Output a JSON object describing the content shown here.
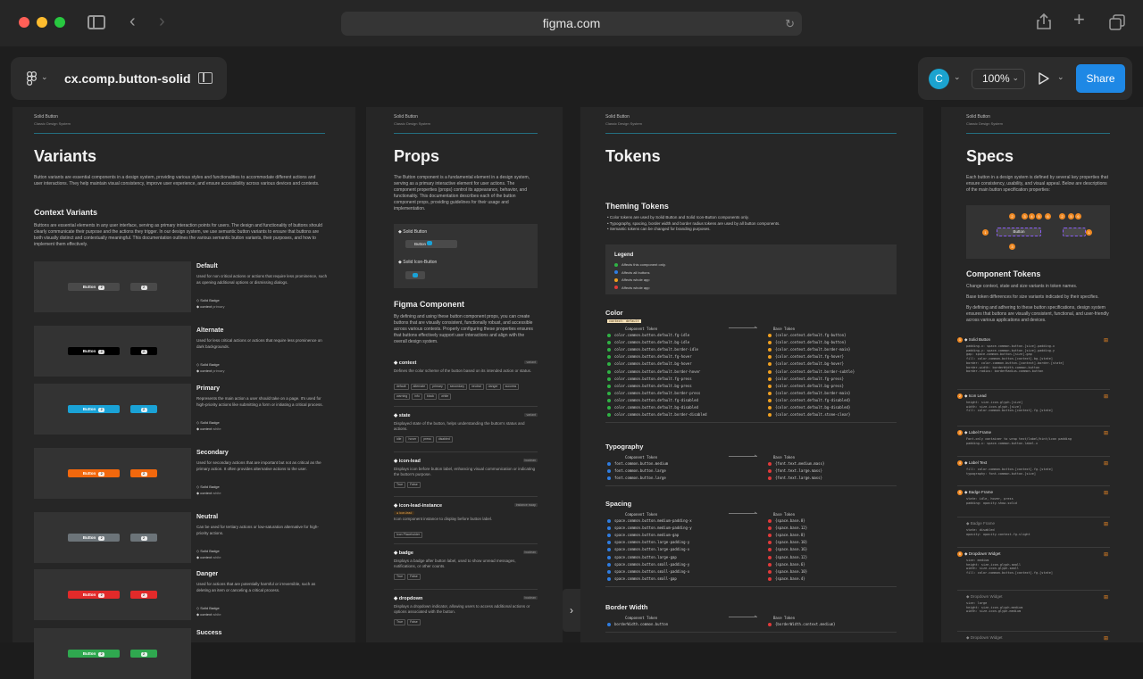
{
  "browser": {
    "url": "figma.com"
  },
  "figma": {
    "file_name": "cx.comp.button-solid",
    "avatar_initial": "C",
    "zoom": "100%",
    "share_label": "Share"
  },
  "frames": {
    "variants": {
      "breadcrumb": "Solid Button",
      "system": "Classic Design System",
      "title": "Variants",
      "intro": "Button variants are essential components in a design system, providing various styles and functionalities to accommodate different actions and user interactions. They help maintain visual consistency, improve user experience, and ensure accessibility across various devices and contexts.",
      "context_heading": "Context Variants",
      "context_intro": "Buttons are essential elements in any user interface, serving as primary interaction points for users. The design and functionality of buttons should clearly communicate their purpose and the actions they trigger. In our design system, we use semantic button variants to ensure that buttons are both visually distinct and contextually meaningful. This documentation outlines the various semantic button variants, their purposes, and how to implement them effectively.",
      "badge_label": "Solid Badge",
      "context_label": "context",
      "button_label": "Button",
      "badge_count": "2",
      "items": [
        {
          "name": "Default",
          "desc": "Used for non critical actions or actions that require less prominence, such as opening additional options or dismissing dialogs.",
          "context": "primary"
        },
        {
          "name": "Alternate",
          "desc": "Used for less critical actions or actions that require less prominence on dark backgrounds.",
          "context": "primary"
        },
        {
          "name": "Primary",
          "desc": "Represents the main action a user should take on a page. It's used for high-priority actions like submitting a form or initiating a critical process.",
          "context": "white"
        },
        {
          "name": "Secondary",
          "desc": "Used for secondary actions that are important but not as critical as the primary action. It often provides alternative actions to the user.",
          "context": "white"
        },
        {
          "name": "Neutral",
          "desc": "Can be used for tertiary actions or low-saturation alternative for high-priority actions.",
          "context": "white"
        },
        {
          "name": "Danger",
          "desc": "Used for actions that are potentially harmful or irreversible, such as deleting an item or canceling a critical process.",
          "context": "white"
        },
        {
          "name": "Success",
          "desc": "",
          "context": ""
        }
      ]
    },
    "props": {
      "breadcrumb": "Solid Button",
      "system": "Classic Design System",
      "title": "Props",
      "intro": "The Button component is a fundamental element in a design system, serving as a primary interactive element for user actions. The component properties (props) control its appearance, behavior, and functionality. This documentation describes each of the button component props, providing guidelines for their usage and implementation.",
      "preview_a": "Solid Button",
      "preview_b": "Solid Icon-Button",
      "button_label": "Button",
      "figma_heading": "Figma Component",
      "figma_text": "By defining and using these button component props, you can create buttons that are visually consistent, functionally robust, and accessible across various contexts. Properly configuring these properties ensures that buttons effectively support user interactions and align with the overall design system.",
      "items": [
        {
          "name": "context",
          "type": "variant",
          "desc": "Defines the color scheme of the button based on its intended action or status.",
          "chips": [
            "default",
            "alternate",
            "primary",
            "secondary",
            "neutral",
            "danger",
            "success",
            "warning",
            "info",
            "black",
            "white"
          ]
        },
        {
          "name": "state",
          "type": "variant",
          "desc": "Displayed state of the button, helps understanding the button's status and actions.",
          "chips": [
            "idle",
            "hover",
            "press",
            "disabled"
          ]
        },
        {
          "name": "icon-lead",
          "type": "boolean",
          "desc": "Displays icon before button label, enhancing visual communication or indicating the button's purpose.",
          "chips": [
            "True",
            "False"
          ]
        },
        {
          "name": "icon-lead-instance",
          "type": "instance swap",
          "desc": "Icon component instance to display before button label.",
          "chips": [
            "Icon Placeholder"
          ],
          "tag": "icon-lead"
        },
        {
          "name": "badge",
          "type": "boolean",
          "desc": "Displays a badge after button label, used to show unread messages, notifications, or other counts.",
          "chips": [
            "True",
            "False"
          ]
        },
        {
          "name": "dropdown",
          "type": "boolean",
          "desc": "Displays a dropdown indicator, allowing users to access additional actions or options associated with the button.",
          "chips": [
            "True",
            "False"
          ]
        }
      ]
    },
    "tokens": {
      "breadcrumb": "Solid Button",
      "system": "Classic Design System",
      "title": "Tokens",
      "theming_heading": "Theming Tokens",
      "theming_points": [
        "Color tokens are used by Solid Button and Solid Icon-Button components only.",
        "Typography, spacing, border width and border radius tokens are used by all button components.",
        "Semantic tokens can be changed for branding purposes."
      ],
      "legend_title": "Legend",
      "legend": [
        {
          "color": "#2fb344",
          "label": "Affects this component only."
        },
        {
          "color": "#2f7de1",
          "label": "Affects all buttons"
        },
        {
          "color": "#f0a020",
          "label": "Affects whole app"
        },
        {
          "color": "#e03a3a",
          "label": "Affects whole app"
        }
      ],
      "component_token_label": "Component Token",
      "base_token_label": "Base Token",
      "color_heading": "Color",
      "color_tag": "context: default",
      "color_rows": [
        [
          "color.common.button.default.fg-idle",
          "{color.context.default.fg-button}"
        ],
        [
          "color.common.button.default.bg-idle",
          "{color.context.default.bg-button}"
        ],
        [
          "color.common.button.default.border-idle",
          "{color.context.default.border-main}"
        ],
        [
          "color.common.button.default.fg-hover",
          "{color.context.default.fg-hover}"
        ],
        [
          "color.common.button.default.bg-hover",
          "{color.context.default.bg-hover}"
        ],
        [
          "color.common.button.default.border-hover",
          "{color.context.default.border-subtle}"
        ],
        [
          "color.common.button.default.fg-press",
          "{color.context.default.fg-press}"
        ],
        [
          "color.common.button.default.bg-press",
          "{color.context.default.bg-press}"
        ],
        [
          "color.common.button.default.border-press",
          "{color.context.default.border-main}"
        ],
        [
          "color.common.button.default.fg-disabled",
          "{color.context.default.fg-disabled}"
        ],
        [
          "color.common.button.default.bg-disabled",
          "{color.context.default.bg-disabled}"
        ],
        [
          "color.common.button.default.border-disabled",
          "{color.context.default.stone-clear}"
        ]
      ],
      "typography_heading": "Typography",
      "typography_rows": [
        [
          "font.common.button.medium",
          "{font.text.medium.mass}"
        ],
        [
          "font.common.button.large",
          "{font.text.large.mass}"
        ],
        [
          "font.common.button.large",
          "{font.text.large.mass}"
        ]
      ],
      "spacing_heading": "Spacing",
      "spacing_rows": [
        [
          "space.common.button.medium-padding-x",
          "{space.base.8}"
        ],
        [
          "space.common.button.medium-padding-y",
          "{space.base.12}"
        ],
        [
          "space.common.button.medium-gap",
          "{space.base.8}"
        ],
        [
          "space.common.button.large-padding-y",
          "{space.base.10}"
        ],
        [
          "space.common.button.large-padding-x",
          "{space.base.16}"
        ],
        [
          "space.common.button.large-gap",
          "{space.base.12}"
        ],
        [
          "space.common.button.small-padding-y",
          "{space.base.6}"
        ],
        [
          "space.common.button.small-padding-x",
          "{space.base.10}"
        ],
        [
          "space.common.button.small-gap",
          "{space.base.4}"
        ]
      ],
      "border_heading": "Border Width",
      "border_rows": [
        [
          "borderWidth.common.button",
          "{borderWidth.context.medium}"
        ]
      ]
    },
    "specs": {
      "breadcrumb": "Solid Button",
      "system": "Classic Design System",
      "title": "Specs",
      "intro": "Each button in a design system is defined by several key properties that ensure consistency, usability, and visual appeal. Below are descriptions of the main button specification properties:",
      "button_label": "Button",
      "component_heading": "Component Tokens",
      "component_line1": "Change context, state and size variants in token names.",
      "component_line2": "Base token differences for size variants indicated by their specifies.",
      "component_line3": "By defining and adhering to these button specifications, design system ensures that buttons are visually consistent, functional, and user-friendly across various applications and devices.",
      "items": [
        {
          "num": "1",
          "name": "Solid Button",
          "lines": [
            "padding-x: space.common.button.[size].padding-x",
            "padding-y: space.common.button.[size].padding-y",
            "gap: space.common.button.[size].gap",
            "fill: color.common.button.[context].bg.[state]",
            "border: color.common.button.[context].border.[state]",
            "border-width: borderWidth.common.button",
            "border-radius: borderRadius.common.button"
          ]
        },
        {
          "num": "2",
          "name": "Icon Lead",
          "lines": [
            "height: size.icon.glyph.[size]",
            "width: size.icon.glyph.[size]",
            "fill: color.common.button.[context].fg.[state]"
          ]
        },
        {
          "num": "3",
          "name": "Label Frame",
          "lines": [
            "Font-only container to wrap text/label/hint/icon padding",
            "padding-x: space.common.button.label.x"
          ]
        },
        {
          "num": "4",
          "name": "Label Text",
          "lines": [
            "fill: color.common.button.[context].fg.[state]",
            "typography: font.common.button.[size]"
          ]
        },
        {
          "num": "5",
          "name": "Badge Frame",
          "lines": [
            "state: idle, hover, press",
            "padding: opacity.show.solid"
          ]
        },
        {
          "num": "",
          "name": "Badge Frame",
          "lines": [
            "state: disabled",
            "opacity: opacity.context.fg-slight"
          ]
        },
        {
          "num": "6",
          "name": "Dropdown Widget",
          "lines": [
            "size: medium",
            "height: size.icon.glyph.small",
            "width: size.icon.glyph.small",
            "fill: color.common.button.[context].fg.[state]"
          ]
        },
        {
          "num": "",
          "name": "Dropdown Widget",
          "lines": [
            "size: large",
            "height: size.icon.glyph.medium",
            "width: size.icon.glyph.medium"
          ]
        },
        {
          "num": "",
          "name": "Dropdown Widget",
          "lines": []
        }
      ]
    }
  },
  "colors": {
    "share": "#1e88e5",
    "accent_rule": "#246d7f",
    "primary_btn": "#1aa2d6",
    "secondary_btn": "#f2680d",
    "neutral_btn": "#6c7479",
    "danger_btn": "#e22a2a",
    "spec_orange": "#f08a24"
  }
}
